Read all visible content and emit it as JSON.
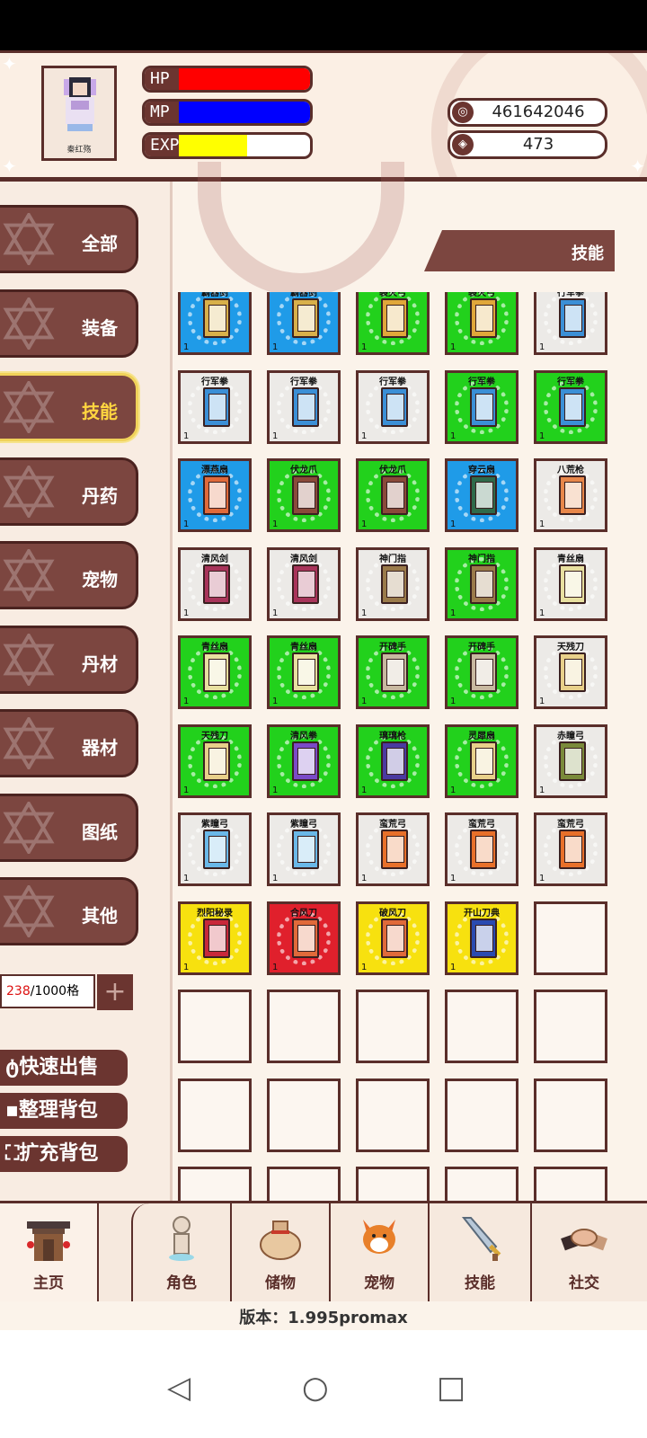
{
  "player": {
    "name": "秦红殇",
    "bars": [
      {
        "label": "HP",
        "color": "#ff0000",
        "fill": 1.0
      },
      {
        "label": "MP",
        "color": "#0000ff",
        "fill": 1.0
      },
      {
        "label": "EXP",
        "color": "#ffff00",
        "fill": 0.52
      }
    ],
    "coins": "461642046",
    "gems": "473"
  },
  "categories": [
    {
      "label": "全部"
    },
    {
      "label": "装备"
    },
    {
      "label": "技能",
      "active": true
    },
    {
      "label": "丹药"
    },
    {
      "label": "宠物"
    },
    {
      "label": "丹材"
    },
    {
      "label": "器材"
    },
    {
      "label": "图纸"
    },
    {
      "label": "其他"
    }
  ],
  "capacity": {
    "used": "238",
    "total": "/1000格"
  },
  "actions": [
    "快速出售",
    "整理背包",
    "扩充背包"
  ],
  "current_tab": "技能",
  "colors": {
    "white": "#eceae7",
    "blue": "#1f9be8",
    "green": "#22d11c",
    "red": "#e0202c",
    "yellow": "#f7e10f"
  },
  "items": [
    {
      "name": "霸器剑",
      "rarity": "blue",
      "book": "#d8b04a",
      "count": "1"
    },
    {
      "name": "霸器剑",
      "rarity": "blue",
      "book": "#d8b04a",
      "count": "1"
    },
    {
      "name": "裂灭弓",
      "rarity": "green",
      "book": "#e0a73a",
      "count": "1"
    },
    {
      "name": "裂灭弓",
      "rarity": "green",
      "book": "#e0a73a",
      "count": "1"
    },
    {
      "name": "行军拳",
      "rarity": "white",
      "book": "#3b8fd6",
      "count": "1"
    },
    {
      "name": "行军拳",
      "rarity": "white",
      "book": "#3b8fd6",
      "count": "1"
    },
    {
      "name": "行军拳",
      "rarity": "white",
      "book": "#3b8fd6",
      "count": "1"
    },
    {
      "name": "行军拳",
      "rarity": "white",
      "book": "#3b8fd6",
      "count": "1"
    },
    {
      "name": "行军拳",
      "rarity": "green",
      "book": "#3b8fd6",
      "count": "1"
    },
    {
      "name": "行军拳",
      "rarity": "green",
      "book": "#3b8fd6",
      "count": "1"
    },
    {
      "name": "漂燕扇",
      "rarity": "blue",
      "book": "#e06a3a",
      "count": "1"
    },
    {
      "name": "伏龙爪",
      "rarity": "green",
      "book": "#8a4a3a",
      "count": "1"
    },
    {
      "name": "伏龙爪",
      "rarity": "green",
      "book": "#8a4a3a",
      "count": "1"
    },
    {
      "name": "穿云扇",
      "rarity": "blue",
      "book": "#2f6a4a",
      "count": "1"
    },
    {
      "name": "八荒枪",
      "rarity": "white",
      "book": "#e8874a",
      "count": "1"
    },
    {
      "name": "清风剑",
      "rarity": "white",
      "book": "#a8345a",
      "count": "1"
    },
    {
      "name": "清风剑",
      "rarity": "white",
      "book": "#a8345a",
      "count": "1"
    },
    {
      "name": "神门指",
      "rarity": "white",
      "book": "#9a7a4a",
      "count": "1"
    },
    {
      "name": "神门指",
      "rarity": "green",
      "book": "#9a7a4a",
      "count": "1"
    },
    {
      "name": "青丝扇",
      "rarity": "white",
      "book": "#e8e0a0",
      "count": "1"
    },
    {
      "name": "青丝扇",
      "rarity": "green",
      "book": "#e8e0a0",
      "count": "1"
    },
    {
      "name": "青丝扇",
      "rarity": "green",
      "book": "#e8e0a0",
      "count": "1"
    },
    {
      "name": "开碑手",
      "rarity": "green",
      "book": "#c8b8a0",
      "count": "1"
    },
    {
      "name": "开碑手",
      "rarity": "green",
      "book": "#c8b8a0",
      "count": "1"
    },
    {
      "name": "天残刀",
      "rarity": "white",
      "book": "#e8d08a",
      "count": "1"
    },
    {
      "name": "天残刀",
      "rarity": "green",
      "book": "#e8d08a",
      "count": "1"
    },
    {
      "name": "清风拳",
      "rarity": "green",
      "book": "#7a4ac8",
      "count": "1"
    },
    {
      "name": "璃璃枪",
      "rarity": "green",
      "book": "#4a3aa0",
      "count": "1"
    },
    {
      "name": "灵犀扇",
      "rarity": "green",
      "book": "#e8d08a",
      "count": "1"
    },
    {
      "name": "赤瞳弓",
      "rarity": "white",
      "book": "#7a8a3a",
      "count": "1"
    },
    {
      "name": "紫瞳弓",
      "rarity": "white",
      "book": "#6ab8e8",
      "count": "1"
    },
    {
      "name": "紫瞳弓",
      "rarity": "white",
      "book": "#6ab8e8",
      "count": "1"
    },
    {
      "name": "蛮荒弓",
      "rarity": "white",
      "book": "#e8702a",
      "count": "1"
    },
    {
      "name": "蛮荒弓",
      "rarity": "white",
      "book": "#e8702a",
      "count": "1"
    },
    {
      "name": "蛮荒弓",
      "rarity": "white",
      "book": "#e8702a",
      "count": "1"
    },
    {
      "name": "烈阳秘录",
      "rarity": "yellow",
      "book": "#c8283a",
      "count": "1"
    },
    {
      "name": "合风刀",
      "rarity": "red",
      "book": "#e06a3a",
      "count": "1"
    },
    {
      "name": "破风刀",
      "rarity": "yellow",
      "book": "#e06a3a",
      "count": "1"
    },
    {
      "name": "开山刀典",
      "rarity": "yellow",
      "book": "#2a4ab0",
      "count": "1"
    }
  ],
  "empty_slots": 16,
  "nav": [
    {
      "label": "主页",
      "icon": "gate-icon"
    },
    {
      "label": "角色",
      "icon": "character-icon"
    },
    {
      "label": "储物",
      "icon": "bag-icon"
    },
    {
      "label": "宠物",
      "icon": "fox-icon"
    },
    {
      "label": "技能",
      "icon": "sword-icon"
    },
    {
      "label": "社交",
      "icon": "handshake-icon"
    }
  ],
  "version": "版本：1.995promax"
}
